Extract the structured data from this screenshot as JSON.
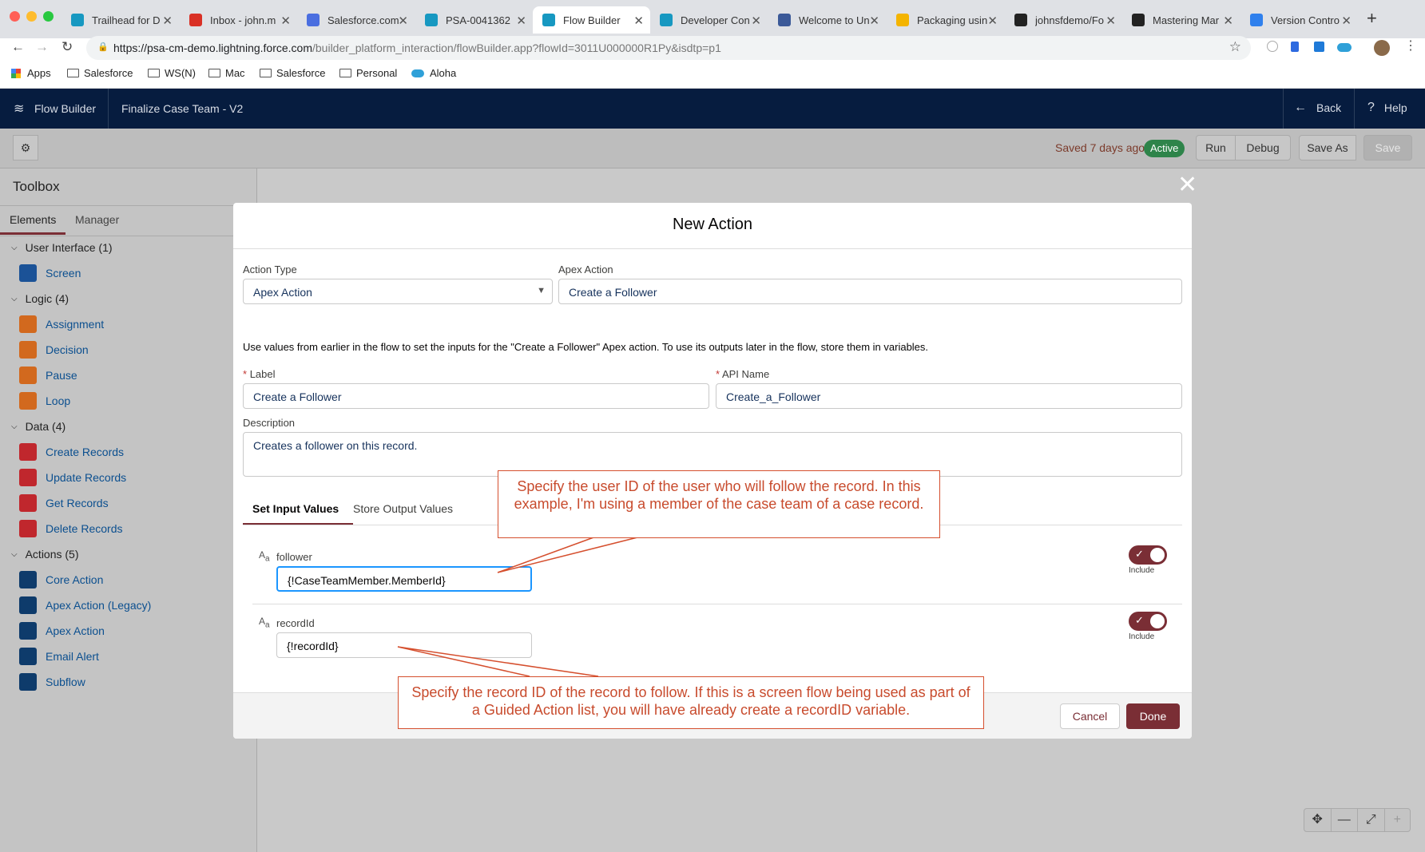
{
  "browser": {
    "tabs": [
      {
        "title": "Trailhead for D",
        "icon": "salesforce-cloud-icon",
        "color": "#1798c1"
      },
      {
        "title": "Inbox - john.m",
        "icon": "gmail-icon",
        "color": "#d93025"
      },
      {
        "title": "Salesforce.com",
        "icon": "calendar-icon",
        "color": "#4a6ee0"
      },
      {
        "title": "PSA-0041362",
        "icon": "salesforce-cloud-icon",
        "color": "#1798c1"
      },
      {
        "title": "Flow Builder",
        "icon": "salesforce-cloud-icon",
        "color": "#1798c1"
      },
      {
        "title": "Developer Con",
        "icon": "salesforce-cloud-icon",
        "color": "#1798c1"
      },
      {
        "title": "Welcome to Un",
        "icon": "welcome-icon",
        "color": "#3b5998"
      },
      {
        "title": "Packaging usin",
        "icon": "slides-icon",
        "color": "#f4b400"
      },
      {
        "title": "johnsfdemo/Fo",
        "icon": "github-icon",
        "color": "#222222"
      },
      {
        "title": "Mastering Mar",
        "icon": "github-icon",
        "color": "#222222"
      },
      {
        "title": "Version Contro",
        "icon": "vscode-icon",
        "color": "#2f80ed"
      }
    ],
    "url_host": "https://psa-cm-demo.lightning.force.com",
    "url_path": "/builder_platform_interaction/flowBuilder.app?flowId=3011U000000R1Py&isdtp=p1",
    "bookmarks": [
      "Apps",
      "Salesforce",
      "WS(N)",
      "Mac",
      "Salesforce",
      "Personal",
      "Aloha"
    ]
  },
  "header": {
    "app_name": "Flow Builder",
    "flow_name": "Finalize Case Team - V2",
    "back_label": "Back",
    "help_label": "Help"
  },
  "actionbar": {
    "saved_text": "Saved 7 days ago",
    "status_badge": "Active",
    "run": "Run",
    "debug": "Debug",
    "save_as": "Save As",
    "save": "Save"
  },
  "toolbox": {
    "title": "Toolbox",
    "tabs": [
      "Elements",
      "Manager"
    ],
    "sections": [
      {
        "label": "User Interface (1)",
        "items": [
          {
            "label": "Screen",
            "icon": "screen-icon",
            "color": "#1b5297"
          }
        ]
      },
      {
        "label": "Logic (4)",
        "items": [
          {
            "label": "Assignment",
            "icon": "assignment-icon",
            "color": "#d2691e"
          },
          {
            "label": "Decision",
            "icon": "decision-icon",
            "color": "#d2691e"
          },
          {
            "label": "Pause",
            "icon": "pause-icon",
            "color": "#d2691e"
          },
          {
            "label": "Loop",
            "icon": "loop-icon",
            "color": "#d2691e"
          }
        ]
      },
      {
        "label": "Data (4)",
        "items": [
          {
            "label": "Create Records",
            "icon": "create-records-icon",
            "color": "#c0272d"
          },
          {
            "label": "Update Records",
            "icon": "update-records-icon",
            "color": "#c0272d"
          },
          {
            "label": "Get Records",
            "icon": "get-records-icon",
            "color": "#c0272d"
          },
          {
            "label": "Delete Records",
            "icon": "delete-records-icon",
            "color": "#c0272d"
          }
        ]
      },
      {
        "label": "Actions (5)",
        "items": [
          {
            "label": "Core Action",
            "icon": "core-action-icon",
            "color": "#0e3b6b"
          },
          {
            "label": "Apex Action (Legacy)",
            "icon": "apex-legacy-icon",
            "color": "#0e3b6b"
          },
          {
            "label": "Apex Action",
            "icon": "apex-action-icon",
            "color": "#0e3b6b"
          },
          {
            "label": "Email Alert",
            "icon": "email-alert-icon",
            "color": "#0e3b6b"
          },
          {
            "label": "Subflow",
            "icon": "subflow-icon",
            "color": "#0e3b6b"
          }
        ]
      }
    ]
  },
  "modal": {
    "title": "New Action",
    "action_type_label": "Action Type",
    "action_type_value": "Apex Action",
    "apex_action_label": "Apex Action",
    "apex_action_value": "Create a Follower",
    "instructions": "Use values from earlier in the flow to set the inputs for the \"Create a Follower\" Apex action. To use its outputs later in the flow, store them in variables.",
    "label_label": "Label",
    "label_value": "Create a Follower",
    "api_name_label": "API Name",
    "api_name_value": "Create_a_Follower",
    "required_mark": "*",
    "description_label": "Description",
    "description_value": "Creates a follower on this record.",
    "tabs": [
      "Set Input Values",
      "Store Output Values"
    ],
    "type_glyph_a": "A",
    "type_glyph_b": "a",
    "params": [
      {
        "name": "follower",
        "value": "{!CaseTeamMember.MemberId}",
        "include": "Include"
      },
      {
        "name": "recordId",
        "value": "{!recordId}",
        "include": "Include"
      }
    ],
    "cancel": "Cancel",
    "done": "Done"
  },
  "callouts": {
    "top": "Specify the user ID of the user who will follow the record. In this example, I'm using a member of the case team of a case record.",
    "bottom": "Specify the record ID of the record to follow. If this is a screen flow being used as part of a Guided Action list, you will have already create a recordID variable."
  },
  "colors": {
    "sf_navy": "#061c3f",
    "brand_red": "#7a2e35",
    "active_green": "#2e844a",
    "callout_orange": "#d54f2e"
  }
}
